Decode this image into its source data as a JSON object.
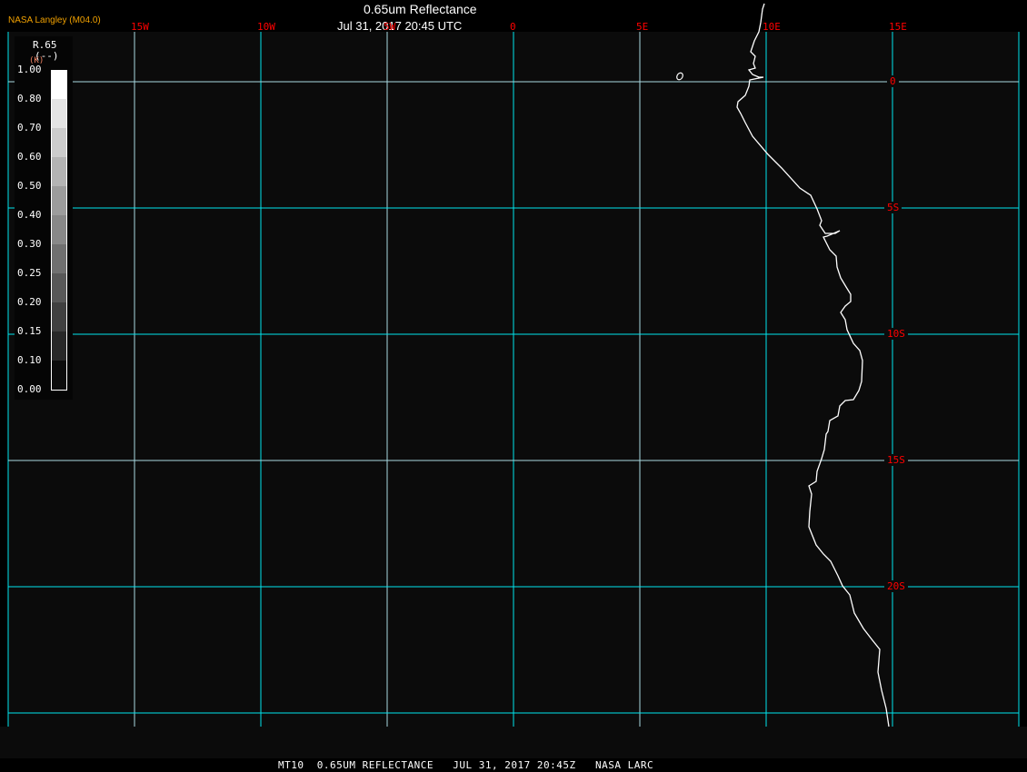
{
  "header": {
    "brand": "NASA Langley (M04.0)",
    "title": "0.65um Reflectance",
    "datetime": "Jul 31, 2017 20:45 UTC"
  },
  "longitude_labels": [
    "15W",
    "10W",
    "5W",
    "0",
    "5E",
    "10E",
    "15E"
  ],
  "latitude_labels": [
    "0",
    "5S",
    "10S",
    "15S",
    "20S"
  ],
  "legend": {
    "variable": "R.65",
    "units": "(--)",
    "units_alt": "(K)",
    "ticks": [
      "1.00",
      "0.80",
      "0.70",
      "0.60",
      "0.50",
      "0.40",
      "0.30",
      "0.25",
      "0.20",
      "0.15",
      "0.10",
      "0.00"
    ],
    "colors": [
      "#ffffff",
      "#e4e4e4",
      "#cccccc",
      "#b4b4b4",
      "#9c9c9c",
      "#888888",
      "#707070",
      "#585858",
      "#404040",
      "#282828",
      "#0c0c0c"
    ]
  },
  "colors": {
    "grid": "#00e5ee",
    "grid_alt": "#a8d8e0",
    "labels": "#ff0000",
    "coastline": "#ffffff"
  },
  "footer": "MT10  0.65UM REFLECTANCE   JUL 31, 2017 20:45Z   NASA LARC"
}
